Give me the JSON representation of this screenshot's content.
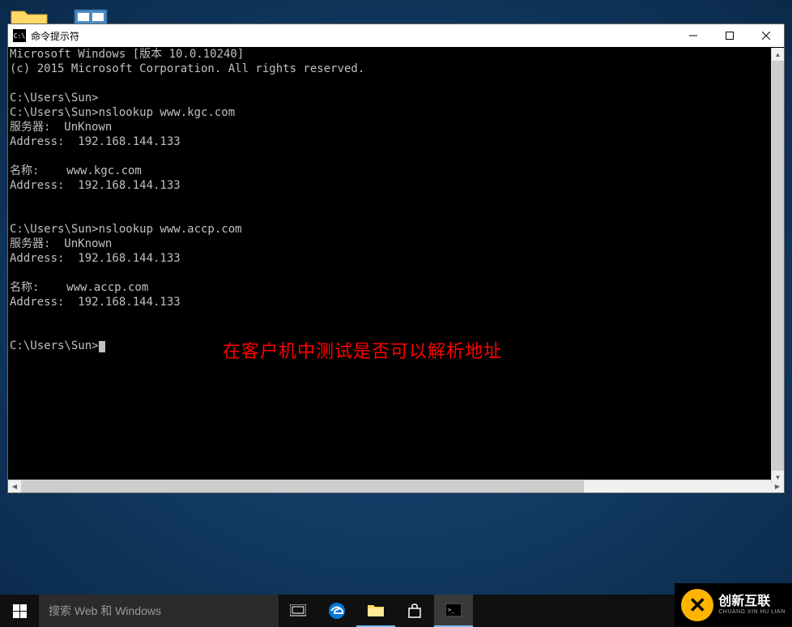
{
  "window": {
    "title": "命令提示符",
    "icon_text": "C:\\"
  },
  "terminal": {
    "lines": [
      "Microsoft Windows [版本 10.0.10240]",
      "(c) 2015 Microsoft Corporation. All rights reserved.",
      "",
      "C:\\Users\\Sun>",
      "C:\\Users\\Sun>nslookup www.kgc.com",
      "服务器:  UnKnown",
      "Address:  192.168.144.133",
      "",
      "名称:    www.kgc.com",
      "Address:  192.168.144.133",
      "",
      "",
      "C:\\Users\\Sun>nslookup www.accp.com",
      "服务器:  UnKnown",
      "Address:  192.168.144.133",
      "",
      "名称:    www.accp.com",
      "Address:  192.168.144.133",
      "",
      "",
      "C:\\Users\\Sun>"
    ],
    "annotation": "在客户机中测试是否可以解析地址"
  },
  "search": {
    "placeholder": "搜索 Web 和 Windows"
  },
  "watermark": {
    "cn": "创新互联",
    "en": "CHUANG XIN HU LIAN"
  }
}
